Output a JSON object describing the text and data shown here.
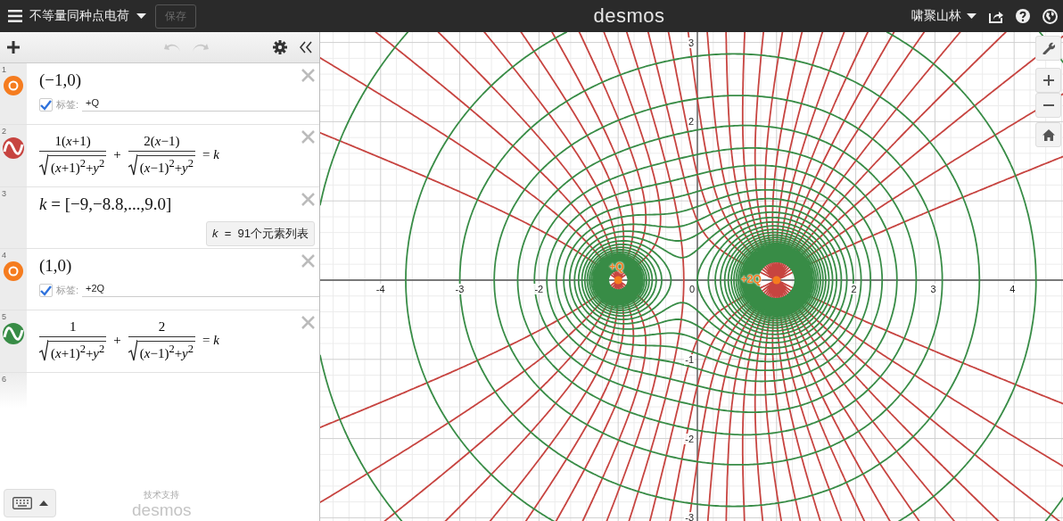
{
  "topbar": {
    "title": "不等量同种点电荷",
    "save_button": {
      "label": "保存",
      "disabled": true
    },
    "logo": "desmos",
    "user": "啸聚山林"
  },
  "toolbar": {
    "undo_disabled": true,
    "redo_disabled": true
  },
  "expressions": [
    {
      "number": "1",
      "kind": "point",
      "color": "#f57c1f",
      "math": "(−1,0)",
      "label_shown": true,
      "label_caption": "标签:",
      "label": "+Q"
    },
    {
      "number": "2",
      "kind": "equation",
      "color": "#c74440",
      "fractions": [
        {
          "num": "1(*x*+1)",
          "den": "(*x*+1)$^{2}$+*y*$^{2}$"
        },
        {
          "num": "2(*x*−1)",
          "den": "(*x*−1)$^{2}$+*y*$^{2}$"
        }
      ],
      "joiner": "+",
      "rhs": "= *k*"
    },
    {
      "number": "3",
      "kind": "list",
      "math": "*k* = [−9,−8.8,...,9.0]",
      "summary": "*k*  =  91个元素列表"
    },
    {
      "number": "4",
      "kind": "point",
      "color": "#f57c1f",
      "math": "(1,0)",
      "label_shown": true,
      "label_caption": "标签:",
      "label": "+2Q"
    },
    {
      "number": "5",
      "kind": "equation",
      "color": "#388c46",
      "fractions": [
        {
          "num": "1",
          "den": "(*x*+1)$^{2}$+*y*$^{2}$"
        },
        {
          "num": "2",
          "den": "(*x*−1)$^{2}$+*y*$^{2}$"
        }
      ],
      "joiner": "+",
      "rhs": "= *k*"
    },
    {
      "number": "6",
      "kind": "empty"
    }
  ],
  "footer": {
    "powered_by": "技术支持",
    "brand": "desmos"
  },
  "graph": {
    "x_tick_labels": [
      "-4",
      "-3",
      "-2",
      "0",
      "2",
      "3",
      "4"
    ],
    "y_tick_labels": [
      "3",
      "2",
      "-1",
      "-2",
      "-3"
    ],
    "point_labels": [
      "+Q",
      "+2Q"
    ]
  }
}
